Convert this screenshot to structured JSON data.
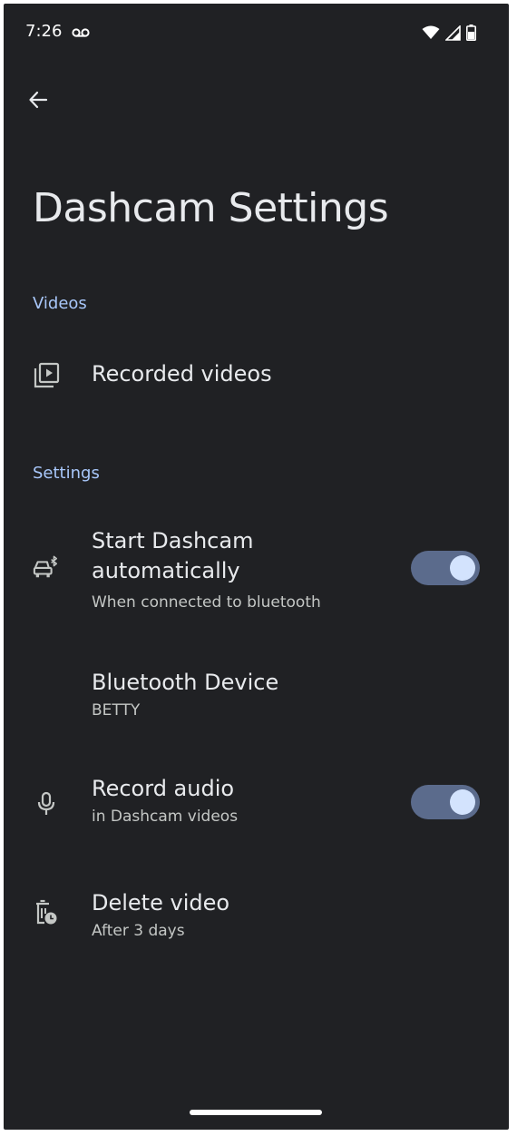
{
  "status_bar": {
    "time": "7:26",
    "icons": [
      "voicemail-icon",
      "wifi-icon",
      "cell-signal-icon",
      "battery-icon"
    ]
  },
  "header": {
    "back_icon": "arrow-back-icon",
    "title": "Dashcam Settings"
  },
  "sections": {
    "videos": {
      "header": "Videos",
      "items": [
        {
          "icon": "video-library-icon",
          "title": "Recorded videos"
        }
      ]
    },
    "settings": {
      "header": "Settings",
      "items": [
        {
          "icon": "car-bluetooth-icon",
          "title_line1": "Start Dashcam",
          "title_line2": "automatically",
          "subtitle": "When connected to bluetooth",
          "toggle_on": true
        },
        {
          "title": "Bluetooth Device",
          "subtitle": "BETTY"
        },
        {
          "icon": "microphone-icon",
          "title": "Record audio",
          "subtitle": "in Dashcam videos",
          "toggle_on": true
        },
        {
          "icon": "delete-clock-icon",
          "title": "Delete video",
          "subtitle": "After 3 days"
        }
      ]
    }
  },
  "colors": {
    "background": "#202124",
    "accent_header": "#a8c7fa",
    "toggle_track": "#5b6b8c",
    "toggle_knob": "#d3e3fd"
  }
}
